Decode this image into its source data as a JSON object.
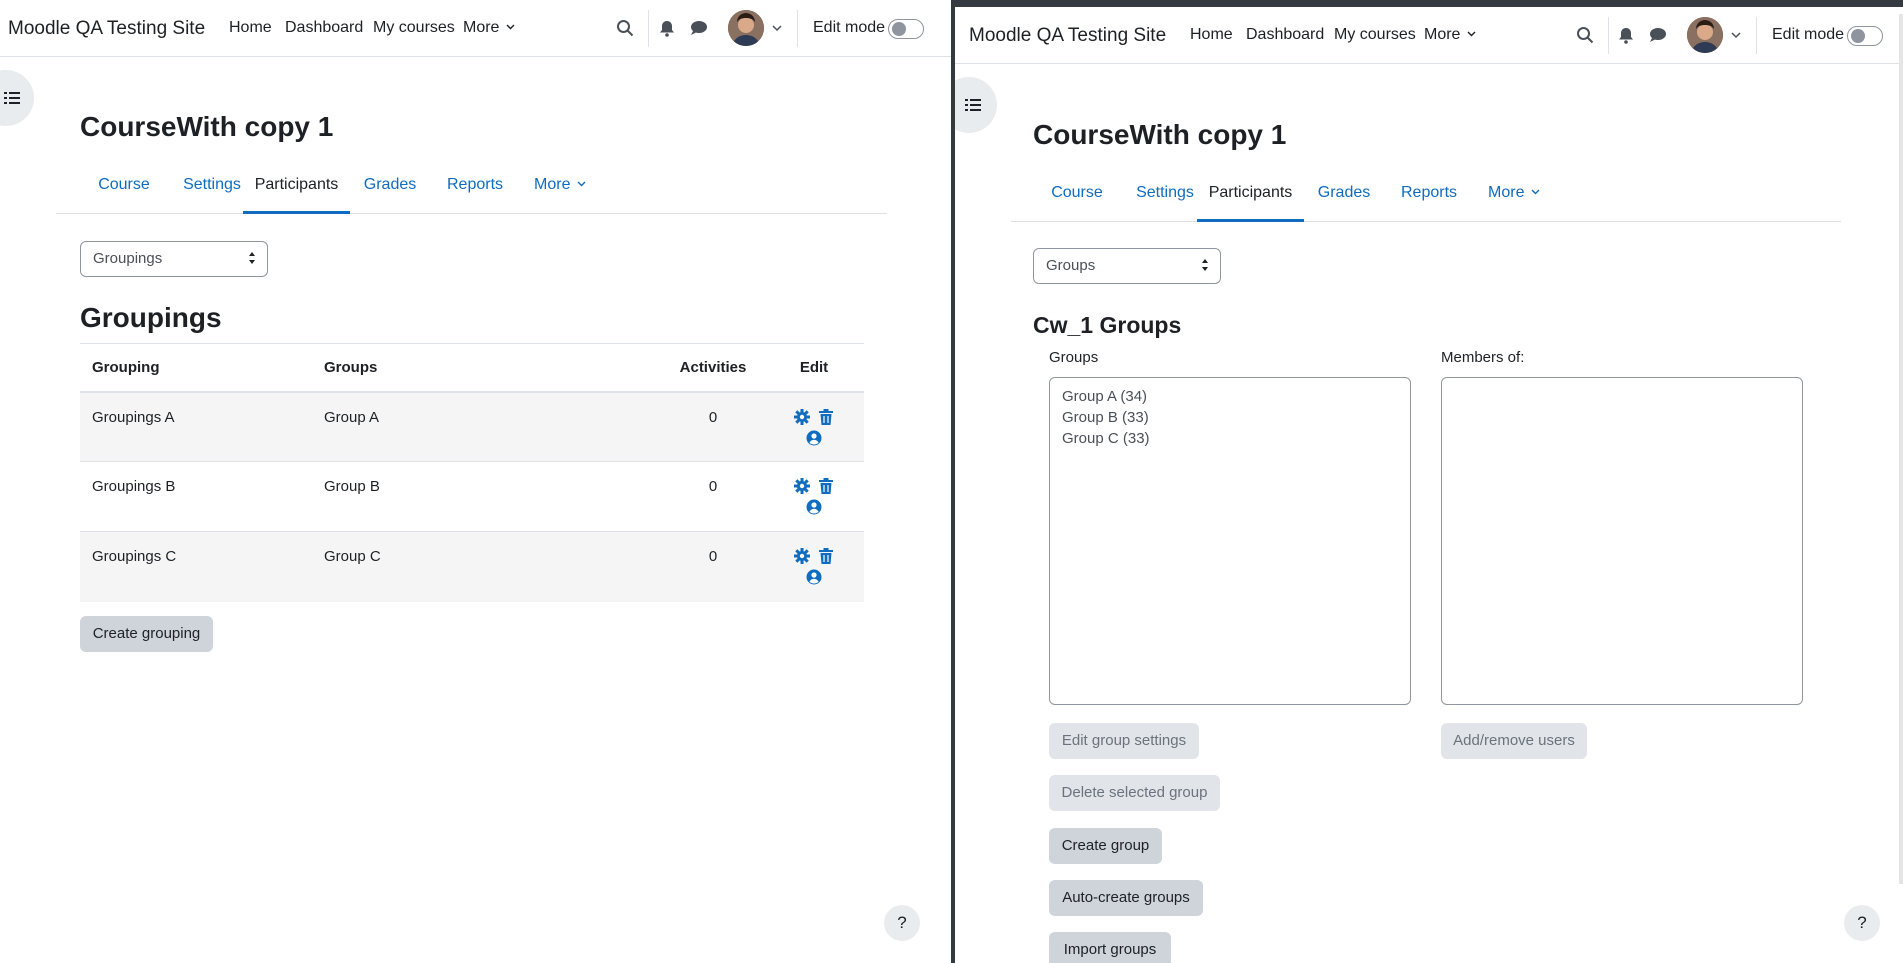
{
  "site_name": "Moodle QA Testing Site",
  "nav": {
    "home": "Home",
    "dashboard": "Dashboard",
    "my_courses": "My courses",
    "more": "More",
    "edit_mode": "Edit mode"
  },
  "course_title": "CourseWith copy 1",
  "tabs": [
    "Course",
    "Settings",
    "Participants",
    "Grades",
    "Reports",
    "More"
  ],
  "active_tab": "Participants",
  "left": {
    "selector_value": "Groupings",
    "heading": "Groupings",
    "table": {
      "headers": {
        "grouping": "Grouping",
        "groups": "Groups",
        "activities": "Activities",
        "edit": "Edit"
      },
      "rows": [
        {
          "grouping": "Groupings A",
          "groups": "Group A",
          "activities": "0"
        },
        {
          "grouping": "Groupings B",
          "groups": "Group B",
          "activities": "0"
        },
        {
          "grouping": "Groupings C",
          "groups": "Group C",
          "activities": "0"
        }
      ]
    },
    "create_button": "Create grouping"
  },
  "right": {
    "selector_value": "Groups",
    "heading": "Cw_1 Groups",
    "groups_label": "Groups",
    "members_label": "Members of:",
    "groups": [
      "Group A (34)",
      "Group B (33)",
      "Group C (33)"
    ],
    "buttons": {
      "edit_group_settings": "Edit group settings",
      "delete_selected_group": "Delete selected group",
      "create_group": "Create group",
      "auto_create_groups": "Auto-create groups",
      "import_groups": "Import groups",
      "add_remove_users": "Add/remove users"
    }
  },
  "help_label": "?",
  "icons": [
    "search-icon",
    "bell-icon",
    "chat-icon",
    "avatar",
    "chevron-down-icon",
    "course-index-icon",
    "gear-icon",
    "trash-icon",
    "user-circle-icon",
    "select-arrows-icon"
  ],
  "colors": {
    "link": "#0f6cbf",
    "text": "#1d2125",
    "button": "#ced4da",
    "button_disabled": "#e1e4e8",
    "table_stripe": "#f5f5f5"
  }
}
